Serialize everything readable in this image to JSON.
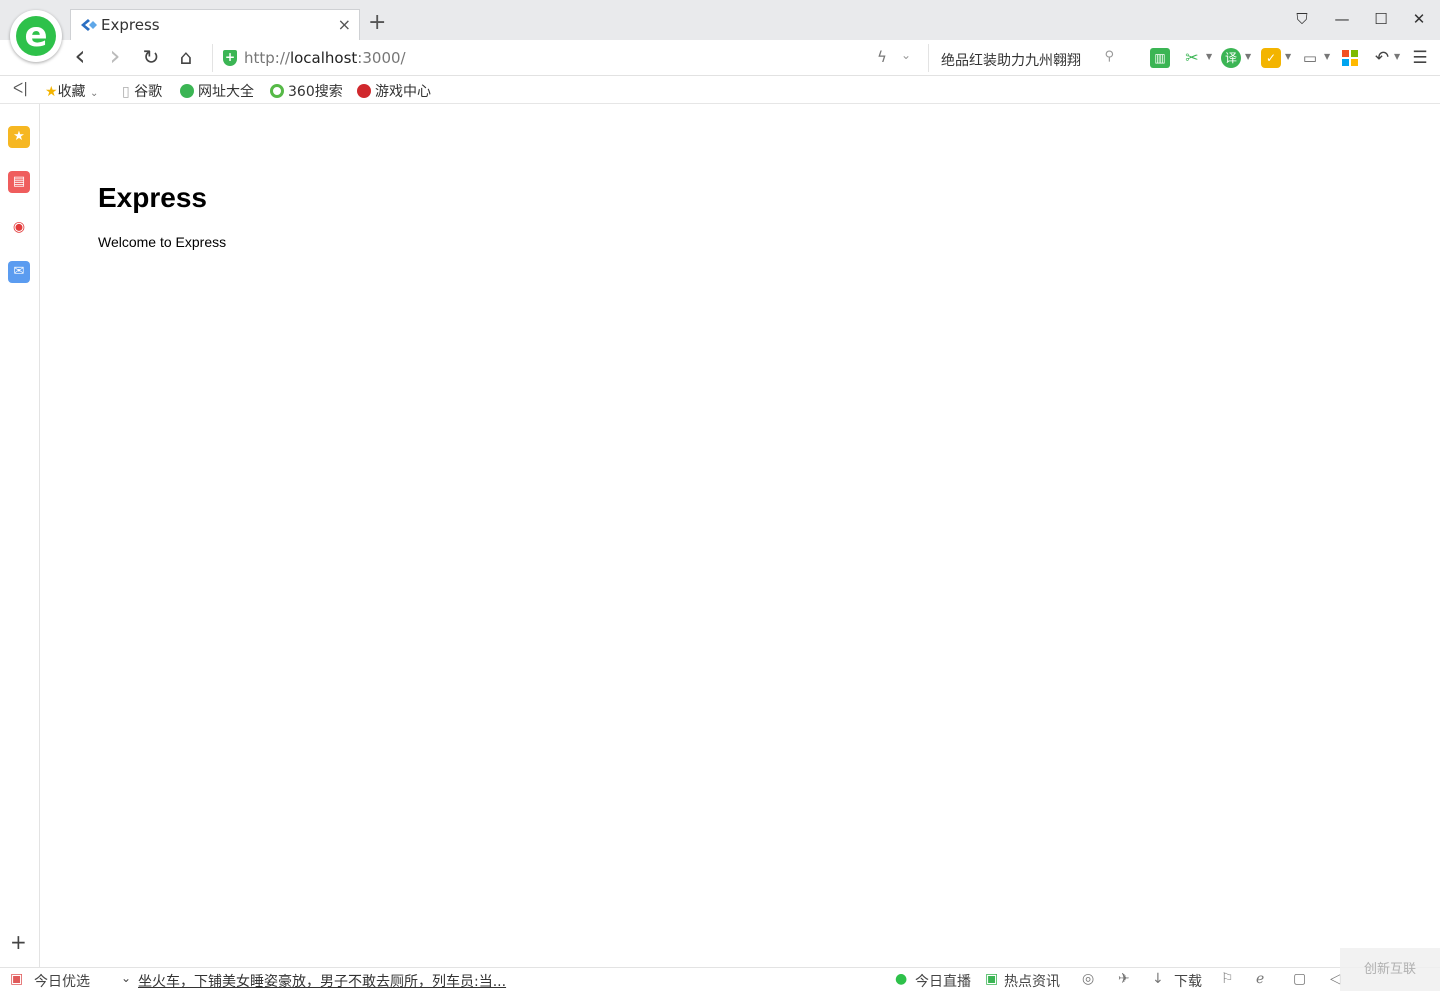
{
  "browser": {
    "logo_letter": "e",
    "tab": {
      "title": "Express",
      "close": "×"
    },
    "new_tab": "+",
    "window_controls": {
      "skin": "⛉",
      "minimize": "—",
      "maximize": "☐",
      "close": "✕"
    }
  },
  "nav": {
    "back": "‹",
    "forward": "›",
    "reload": "↻",
    "home": "⌂",
    "url_scheme": "http://",
    "url_host": "localhost",
    "url_rest": ":3000/",
    "search_text": "绝品红装助力九州翱翔"
  },
  "bookmarks": {
    "collapse": "ᐸ|",
    "items": [
      {
        "label": "收藏",
        "icon": "star-icon",
        "color": "#f3b400"
      },
      {
        "label": "谷歌",
        "icon": "document-icon",
        "color": "#bbbbbb"
      },
      {
        "label": "网址大全",
        "icon": "plus-circle-icon",
        "color": "#3bb554"
      },
      {
        "label": "360搜索",
        "icon": "search-ring-icon",
        "color": "#56b947"
      },
      {
        "label": "游戏中心",
        "icon": "game-icon",
        "color": "#d0282d"
      }
    ]
  },
  "sidebar": {
    "items": [
      {
        "name": "favorites",
        "icon": "star-icon",
        "color": "#f6b722"
      },
      {
        "name": "reader",
        "icon": "reader-icon",
        "color": "#ef5d5d"
      },
      {
        "name": "weibo",
        "icon": "weibo-icon",
        "color": "#e33b3b"
      },
      {
        "name": "mail",
        "icon": "mail-icon",
        "color": "#5b9cf0"
      }
    ],
    "add": "+"
  },
  "page": {
    "heading": "Express",
    "body": "Welcome to Express"
  },
  "status": {
    "left_label": "今日优选",
    "news_chevron": "⌄",
    "news": "坐火车，下铺美女睡姿豪放，男子不敢去厕所，列车员:当...",
    "live": "今日直播",
    "hot": "热点资讯",
    "download": "下载"
  },
  "watermark": "创新互联"
}
